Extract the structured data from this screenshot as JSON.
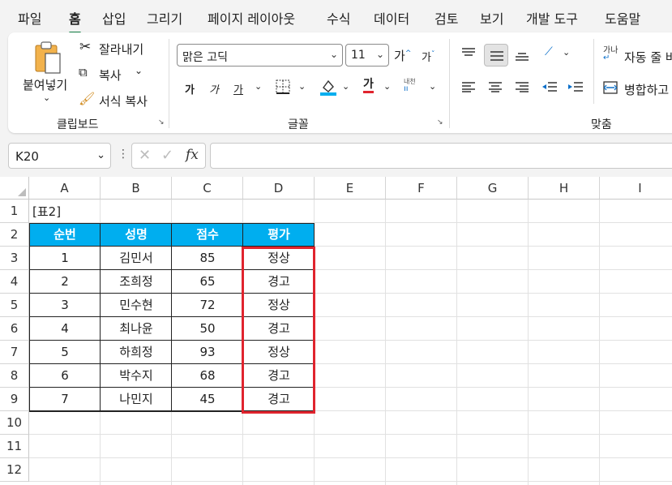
{
  "menu": {
    "tabs": [
      "파일",
      "홈",
      "삽입",
      "그리기",
      "페이지 레이아웃",
      "수식",
      "데이터",
      "검토",
      "보기",
      "개발 도구",
      "도움말"
    ],
    "active": "홈"
  },
  "ribbon": {
    "clipboard": {
      "paste_label": "붙여넣기",
      "cut_label": "잘라내기",
      "copy_label": "복사",
      "format_painter_label": "서식 복사",
      "group_label": "클립보드"
    },
    "font": {
      "font_name": "맑은 고딕",
      "font_size": "11",
      "grow_label": "가",
      "shrink_label": "가",
      "bold_label": "가",
      "italic_label": "가",
      "underline_label": "가",
      "font_color_label": "가",
      "phonetic_label": "내천",
      "group_label": "글꼴"
    },
    "alignment": {
      "wrap_label": "자동 줄 바",
      "merge_label": "병합하고",
      "group_label": "맞춤"
    }
  },
  "formula_bar": {
    "name_box": "K20",
    "fx_label": "fx",
    "formula": ""
  },
  "sheet": {
    "columns": [
      "A",
      "B",
      "C",
      "D",
      "E",
      "F",
      "G",
      "H",
      "I"
    ],
    "rows": [
      "1",
      "2",
      "3",
      "4",
      "5",
      "6",
      "7",
      "8",
      "9",
      "10",
      "11",
      "12"
    ],
    "title_cell": "[표2]",
    "table_headers": [
      "순번",
      "성명",
      "점수",
      "평가"
    ],
    "table_rows": [
      [
        "1",
        "김민서",
        "85",
        "정상"
      ],
      [
        "2",
        "조희정",
        "65",
        "경고"
      ],
      [
        "3",
        "민수현",
        "72",
        "정상"
      ],
      [
        "4",
        "최나윤",
        "50",
        "경고"
      ],
      [
        "5",
        "하희정",
        "93",
        "정상"
      ],
      [
        "6",
        "박수지",
        "68",
        "경고"
      ],
      [
        "7",
        "나민지",
        "45",
        "경고"
      ]
    ],
    "colors": {
      "header_fill": "#00aeef",
      "highlight_border": "#e0242e",
      "accent": "#107c41"
    }
  }
}
